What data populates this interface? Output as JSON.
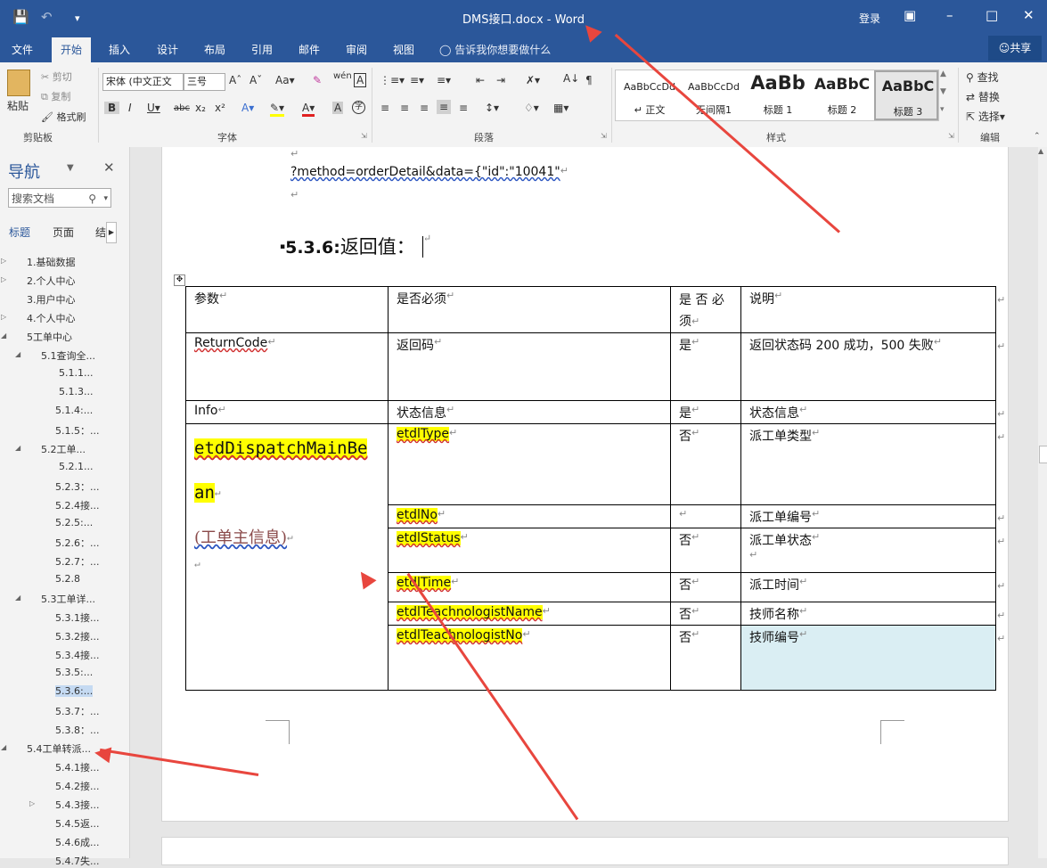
{
  "window": {
    "title": "DMS接口.docx - Word",
    "login": "登录"
  },
  "ribbon_tabs": [
    "文件",
    "开始",
    "插入",
    "设计",
    "布局",
    "引用",
    "邮件",
    "审阅",
    "视图"
  ],
  "tell_me": "告诉我你想要做什么",
  "share": "共享",
  "clipboard": {
    "paste": "粘贴",
    "cut": "剪切",
    "copy": "复制",
    "format_painter": "格式刷",
    "label": "剪贴板"
  },
  "font": {
    "name": "宋体 (中文正文",
    "size": "三号",
    "label": "字体",
    "phonetic": "wén"
  },
  "paragraph": {
    "label": "段落"
  },
  "styles": {
    "label": "样式",
    "items": [
      {
        "preview": "AaBbCcDd",
        "name": "正文"
      },
      {
        "preview": "AaBbCcDd",
        "name": "无间隔1"
      },
      {
        "preview": "AaBb",
        "name": "标题 1"
      },
      {
        "preview": "AaBbC",
        "name": "标题 2"
      },
      {
        "preview": "AaBbC",
        "name": "标题 3"
      }
    ]
  },
  "editing": {
    "find": "查找",
    "replace": "替换",
    "select": "选择",
    "label": "编辑"
  },
  "nav": {
    "title": "导航",
    "search_placeholder": "搜索文档",
    "tabs": [
      "标题",
      "页面",
      "结"
    ],
    "items": [
      {
        "text": "1.基础数据",
        "level": 0,
        "exp": "▷"
      },
      {
        "text": "2.个人中心",
        "level": 0,
        "exp": "▷"
      },
      {
        "text": "3.用户中心",
        "level": 0,
        "exp": ""
      },
      {
        "text": "4.个人中心",
        "level": 0,
        "exp": "▷"
      },
      {
        "text": "5工单中心",
        "level": 0,
        "exp": "◢"
      },
      {
        "text": "5.1查询全...",
        "level": 1,
        "exp": "◢"
      },
      {
        "text": "5.1.1...",
        "level": 3,
        "exp": ""
      },
      {
        "text": "5.1.3...",
        "level": 3,
        "exp": ""
      },
      {
        "text": "5.1.4:...",
        "level": 2,
        "exp": ""
      },
      {
        "text": "5.1.5：...",
        "level": 2,
        "exp": ""
      },
      {
        "text": "5.2工单...",
        "level": 1,
        "exp": "◢"
      },
      {
        "text": "5.2.1...",
        "level": 3,
        "exp": ""
      },
      {
        "text": "5.2.3：...",
        "level": 2,
        "exp": ""
      },
      {
        "text": "5.2.4接...",
        "level": 2,
        "exp": ""
      },
      {
        "text": "5.2.5:...",
        "level": 2,
        "exp": ""
      },
      {
        "text": "5.2.6：...",
        "level": 2,
        "exp": ""
      },
      {
        "text": "5.2.7：...",
        "level": 2,
        "exp": ""
      },
      {
        "text": "5.2.8",
        "level": 2,
        "exp": ""
      },
      {
        "text": "5.3工单详...",
        "level": 1,
        "exp": "◢"
      },
      {
        "text": "5.3.1接...",
        "level": 2,
        "exp": ""
      },
      {
        "text": "5.3.2接...",
        "level": 2,
        "exp": ""
      },
      {
        "text": "5.3.4接...",
        "level": 2,
        "exp": ""
      },
      {
        "text": "5.3.5:...",
        "level": 2,
        "exp": ""
      },
      {
        "text": "5.3.6:...",
        "level": 2,
        "exp": "",
        "selected": true
      },
      {
        "text": "5.3.7：...",
        "level": 2,
        "exp": ""
      },
      {
        "text": "5.3.8：...",
        "level": 2,
        "exp": ""
      },
      {
        "text": "5.4工单转派...",
        "level": 0,
        "exp": "◢"
      },
      {
        "text": "5.4.1接...",
        "level": 2,
        "exp": ""
      },
      {
        "text": "5.4.2接...",
        "level": 2,
        "exp": ""
      },
      {
        "text": "5.4.3接...",
        "level": 2,
        "exp": "▷"
      },
      {
        "text": "5.4.5返...",
        "level": 2,
        "exp": ""
      },
      {
        "text": "5.4.6成...",
        "level": 2,
        "exp": ""
      },
      {
        "text": "5.4.7失...",
        "level": 2,
        "exp": ""
      }
    ]
  },
  "doc": {
    "url_line": "?method=orderDetail&data={\"id\":\"10041\"",
    "heading_num": "5.3.6:",
    "heading_text": "返回值：",
    "table": {
      "header": [
        "参数",
        "是否必须",
        "是 否 必 须",
        "说明"
      ],
      "row_code": [
        "ReturnCode",
        "返回码",
        "是",
        "返回状态码 200 成功，500 失败"
      ],
      "row_info": [
        "Info",
        "状态信息",
        "是",
        "状态信息"
      ],
      "bean_line1": "etdDispatchMainBe",
      "bean_line2": "an",
      "bean_desc": "(工单主信息)",
      "sub_rows": [
        {
          "param": "etdlType",
          "req": "否",
          "desc": "派工单类型"
        },
        {
          "param": "etdlNo",
          "req": "",
          "desc": "派工单编号"
        },
        {
          "param": "etdlStatus",
          "req": "否",
          "desc": "派工单状态"
        },
        {
          "param": "etdlTime",
          "req": "否",
          "desc": "派工时间"
        },
        {
          "param": "etdlTeachnologistName",
          "req": "否",
          "desc": "技师名称"
        },
        {
          "param": "etdlTeachnologistNo",
          "req": "否",
          "desc": "技师编号"
        }
      ]
    }
  },
  "colors": {
    "word_blue": "#2b579a",
    "highlight": "#ffff00",
    "arrow": "#e8463e"
  }
}
